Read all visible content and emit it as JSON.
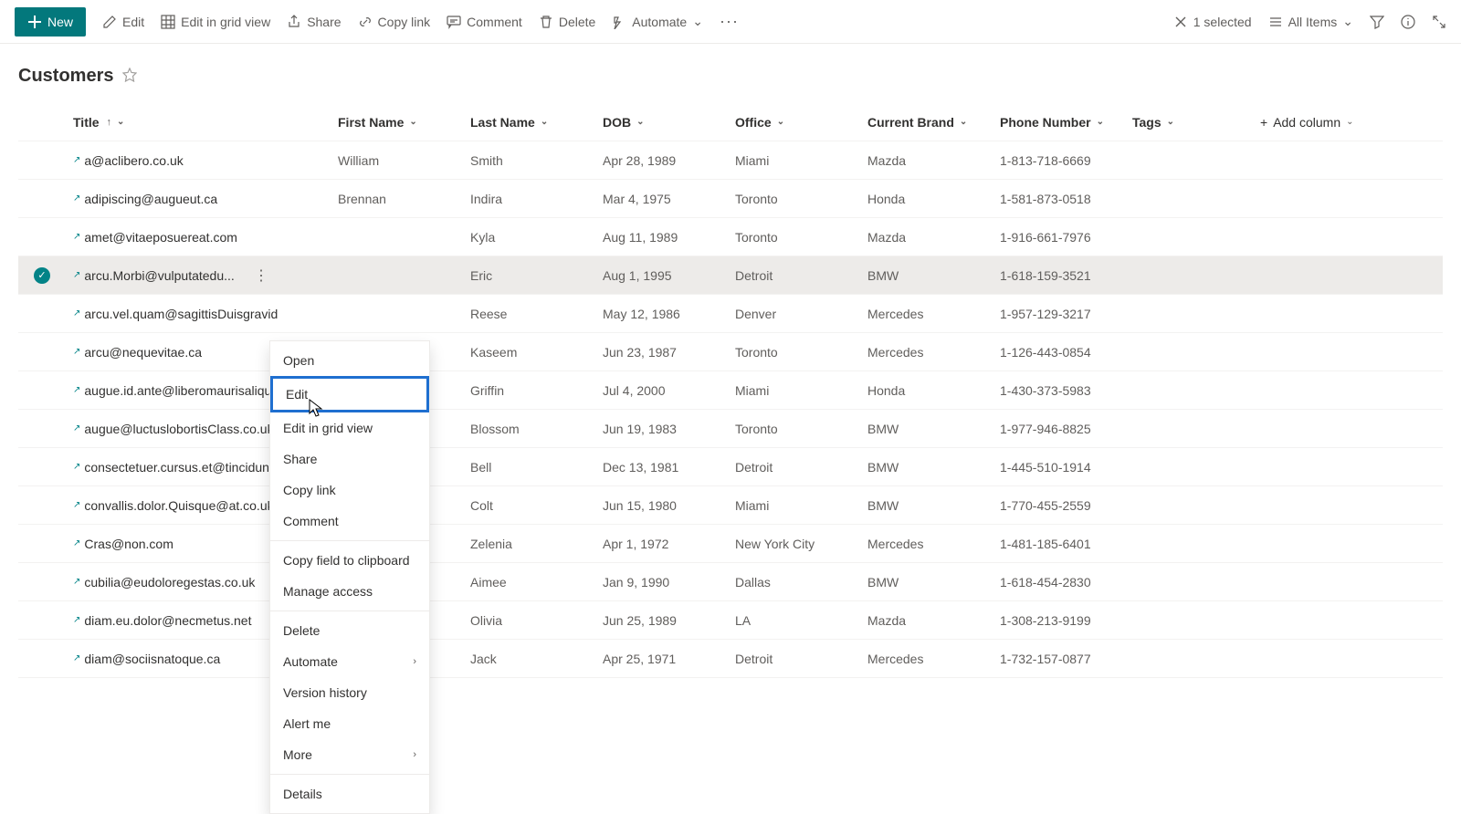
{
  "toolbar": {
    "new_label": "New",
    "edit_label": "Edit",
    "grid_label": "Edit in grid view",
    "share_label": "Share",
    "copy_link_label": "Copy link",
    "comment_label": "Comment",
    "delete_label": "Delete",
    "automate_label": "Automate",
    "selected_label": "1 selected",
    "view_label": "All Items"
  },
  "list": {
    "title": "Customers"
  },
  "columns": {
    "title": "Title",
    "first_name": "First Name",
    "last_name": "Last Name",
    "dob": "DOB",
    "office": "Office",
    "brand": "Current Brand",
    "phone": "Phone Number",
    "tags": "Tags",
    "add": "Add column"
  },
  "rows": [
    {
      "title": "a@aclibero.co.uk",
      "first": "William",
      "last": "Smith",
      "dob": "Apr 28, 1989",
      "office": "Miami",
      "brand": "Mazda",
      "phone": "1-813-718-6669"
    },
    {
      "title": "adipiscing@augueut.ca",
      "first": "Brennan",
      "last": "Indira",
      "dob": "Mar 4, 1975",
      "office": "Toronto",
      "brand": "Honda",
      "phone": "1-581-873-0518"
    },
    {
      "title": "amet@vitaeposuereat.com",
      "first": "",
      "last": "Kyla",
      "dob": "Aug 11, 1989",
      "office": "Toronto",
      "brand": "Mazda",
      "phone": "1-916-661-7976"
    },
    {
      "title": "arcu.Morbi@vulputatedu...",
      "first": "",
      "last": "Eric",
      "dob": "Aug 1, 1995",
      "office": "Detroit",
      "brand": "BMW",
      "phone": "1-618-159-3521",
      "selected": true
    },
    {
      "title": "arcu.vel.quam@sagittisDuisgravid",
      "first": "",
      "last": "Reese",
      "dob": "May 12, 1986",
      "office": "Denver",
      "brand": "Mercedes",
      "phone": "1-957-129-3217"
    },
    {
      "title": "arcu@nequevitae.ca",
      "first": "",
      "last": "Kaseem",
      "dob": "Jun 23, 1987",
      "office": "Toronto",
      "brand": "Mercedes",
      "phone": "1-126-443-0854"
    },
    {
      "title": "augue.id.ante@liberomaurisaliqua",
      "first": "",
      "last": "Griffin",
      "dob": "Jul 4, 2000",
      "office": "Miami",
      "brand": "Honda",
      "phone": "1-430-373-5983"
    },
    {
      "title": "augue@luctuslobortisClass.co.uk",
      "first": "",
      "last": "Blossom",
      "dob": "Jun 19, 1983",
      "office": "Toronto",
      "brand": "BMW",
      "phone": "1-977-946-8825"
    },
    {
      "title": "consectetuer.cursus.et@tinciduntl",
      "first": "",
      "last": "Bell",
      "dob": "Dec 13, 1981",
      "office": "Detroit",
      "brand": "BMW",
      "phone": "1-445-510-1914"
    },
    {
      "title": "convallis.dolor.Quisque@at.co.uk",
      "first": "",
      "last": "Colt",
      "dob": "Jun 15, 1980",
      "office": "Miami",
      "brand": "BMW",
      "phone": "1-770-455-2559"
    },
    {
      "title": "Cras@non.com",
      "first": "",
      "last": "Zelenia",
      "dob": "Apr 1, 1972",
      "office": "New York City",
      "brand": "Mercedes",
      "phone": "1-481-185-6401"
    },
    {
      "title": "cubilia@eudoloregestas.co.uk",
      "first": "",
      "last": "Aimee",
      "dob": "Jan 9, 1990",
      "office": "Dallas",
      "brand": "BMW",
      "phone": "1-618-454-2830"
    },
    {
      "title": "diam.eu.dolor@necmetus.net",
      "first": "",
      "last": "Olivia",
      "dob": "Jun 25, 1989",
      "office": "LA",
      "brand": "Mazda",
      "phone": "1-308-213-9199"
    },
    {
      "title": "diam@sociisnatoque.ca",
      "first": "",
      "last": "Jack",
      "dob": "Apr 25, 1971",
      "office": "Detroit",
      "brand": "Mercedes",
      "phone": "1-732-157-0877"
    }
  ],
  "context_menu": {
    "open": "Open",
    "edit": "Edit",
    "edit_grid": "Edit in grid view",
    "share": "Share",
    "copy_link": "Copy link",
    "comment": "Comment",
    "copy_field": "Copy field to clipboard",
    "manage": "Manage access",
    "delete": "Delete",
    "automate": "Automate",
    "version": "Version history",
    "alert": "Alert me",
    "more": "More",
    "details": "Details"
  }
}
